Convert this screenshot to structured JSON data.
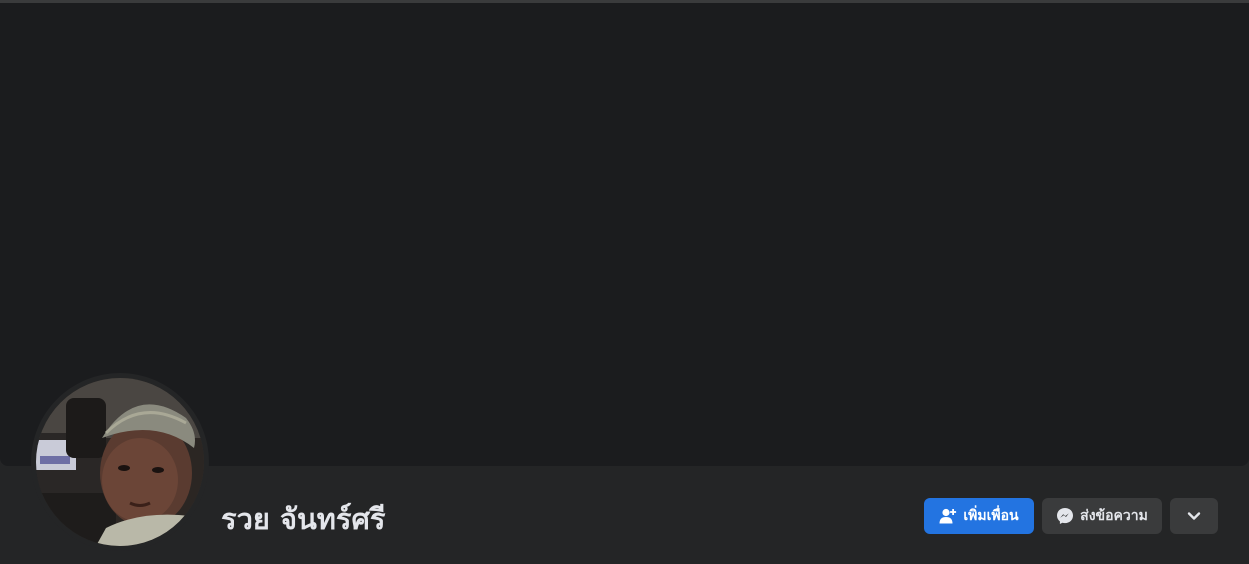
{
  "profile": {
    "name": "รวย จันทร์ศรี",
    "avatar_icon": "profile-photo-child"
  },
  "actions": {
    "add_friend_label": "เพิ่มเพื่อน",
    "add_friend_icon": "person-add-icon",
    "message_label": "ส่งข้อความ",
    "message_icon": "messenger-icon",
    "more_icon": "chevron-down-icon"
  },
  "colors": {
    "background": "#242526",
    "cover": "#1b1c1e",
    "primary_button": "#2374e1",
    "secondary_button": "#3a3b3c",
    "text": "#e4e6eb"
  }
}
